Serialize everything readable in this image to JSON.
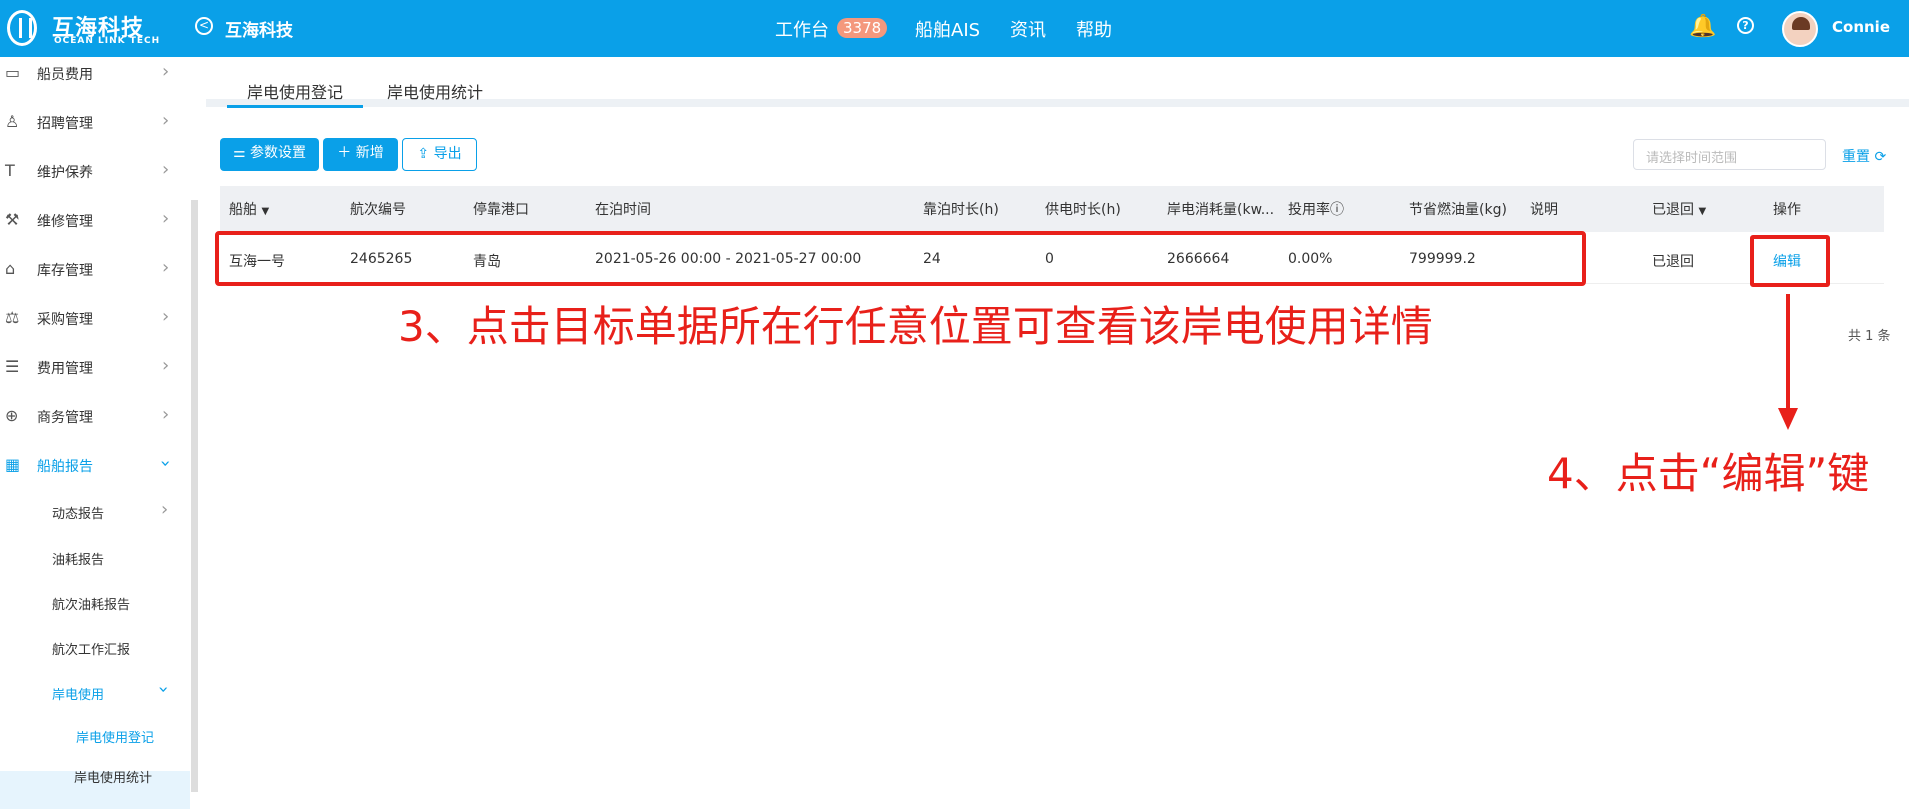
{
  "header": {
    "brand": "互海科技",
    "brand_en": "OCEAN LINK TECH",
    "company": "互海科技",
    "nav": [
      {
        "label": "工作台",
        "badge": "3378"
      },
      {
        "label": "船舶AIS"
      },
      {
        "label": "资讯"
      },
      {
        "label": "帮助"
      }
    ],
    "user": "Connie",
    "help_glyph": "?"
  },
  "sidebar": {
    "items": [
      {
        "icon": "wallet-icon",
        "glyph": "▭",
        "label": "船员费用"
      },
      {
        "icon": "person-icon",
        "glyph": "♙",
        "label": "招聘管理"
      },
      {
        "icon": "hammer-icon",
        "glyph": "T",
        "label": "维护保养"
      },
      {
        "icon": "wrench-icon",
        "glyph": "⚒",
        "label": "维修管理"
      },
      {
        "icon": "home-icon",
        "glyph": "⌂",
        "label": "库存管理"
      },
      {
        "icon": "cart-icon",
        "glyph": "⚖",
        "label": "采购管理"
      },
      {
        "icon": "database-icon",
        "glyph": "☰",
        "label": "费用管理"
      },
      {
        "icon": "globe-icon",
        "glyph": "⊕",
        "label": "商务管理"
      },
      {
        "icon": "calendar-icon",
        "glyph": "▦",
        "label": "船舶报告"
      }
    ],
    "subitems": [
      "动态报告",
      "油耗报告",
      "航次油耗报告",
      "航次工作汇报",
      "岸电使用"
    ],
    "subsub": [
      "岸电使用登记",
      "岸电使用统计"
    ]
  },
  "tabs": [
    "岸电使用登记",
    "岸电使用统计"
  ],
  "toolbar": {
    "params": "参数设置",
    "add": "新增",
    "export": "导出",
    "date_placeholder": "请选择时间范围",
    "reset": "重置"
  },
  "table": {
    "headers": [
      "船舶",
      "航次编号",
      "停靠港口",
      "在泊时间",
      "靠泊时长(h)",
      "供电时长(h)",
      "岸电消耗量(kw...",
      "投用率ⓘ",
      "节省燃油量(kg)",
      "说明",
      "已退回",
      "操作"
    ],
    "rows": [
      {
        "ship": "互海一号",
        "voyage": "2465265",
        "port": "青岛",
        "time": "2021-05-26 00:00 - 2021-05-27 00:00",
        "berth": "24",
        "power": "0",
        "consume": "2666664",
        "rate": "0.00%",
        "save": "799999.2",
        "note": "",
        "status": "已退回",
        "action": "编辑"
      }
    ]
  },
  "pagination": {
    "total": "共 1 条"
  },
  "annotations": {
    "a3": "3、点击目标单据所在行任意位置可查看该岸电使用详情",
    "a4": "4、点击“编辑”键"
  },
  "colors": {
    "primary": "#0aa0e8",
    "annotation": "#e8201a"
  }
}
